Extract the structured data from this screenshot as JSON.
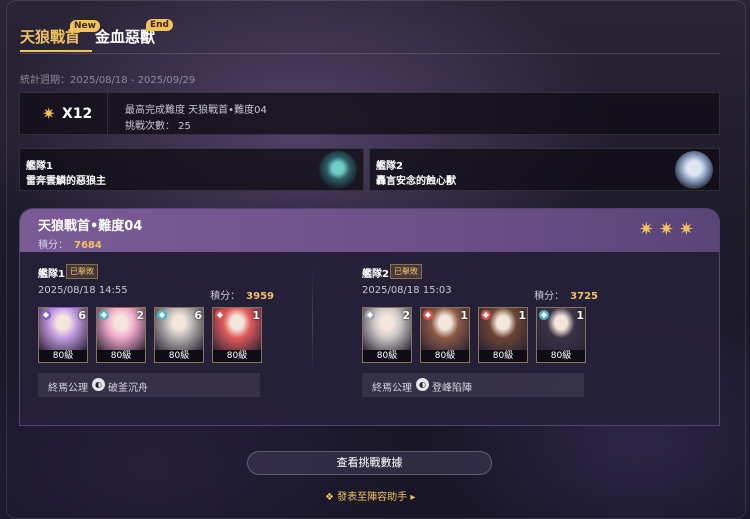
{
  "tabs": [
    {
      "label": "天狼戰首",
      "badge": "New"
    },
    {
      "label": "金血惡獸",
      "badge": "End"
    }
  ],
  "period": "統計週期：2025/08/18 - 2025/09/29",
  "summary": {
    "star_count": "X12",
    "highest_label": "最高完成難度 天狼戰首•難度04",
    "attempts": "挑戰次數： 25"
  },
  "teams": [
    {
      "name": "艦隊1",
      "boss": "雷奔雲鱗的惡狼主",
      "icon": "boss-wolf-icon"
    },
    {
      "name": "艦隊2",
      "boss": "轟言安念的蝕心獸",
      "icon": "boss-beast-icon"
    }
  ],
  "record": {
    "title": "天狼戰首•難度04",
    "score_label": "積分：",
    "score": "7684",
    "stars": "✷✷✷",
    "teams": [
      {
        "name": "艦隊1",
        "status": "已擊敗",
        "date": "2025/08/18 14:55",
        "score_label": "積分：",
        "score": "3959",
        "path": "終焉公理",
        "blessing": "破釜沉舟",
        "chars": [
          {
            "eidolon": "6",
            "level": "80級",
            "color": "#c39be0"
          },
          {
            "eidolon": "2",
            "level": "80級",
            "color": "#f0a9c8"
          },
          {
            "eidolon": "6",
            "level": "80級",
            "color": "#b8b3b0"
          },
          {
            "eidolon": "1",
            "level": "80級",
            "color": "#e05a5a"
          }
        ]
      },
      {
        "name": "艦隊2",
        "status": "已擊敗",
        "date": "2025/08/18 15:03",
        "score_label": "積分：",
        "score": "3725",
        "path": "終焉公理",
        "blessing": "登峰陷陣",
        "chars": [
          {
            "eidolon": "2",
            "level": "80級",
            "color": "#c9c6c2"
          },
          {
            "eidolon": "1",
            "level": "80級",
            "color": "#8a5a44"
          },
          {
            "eidolon": "1",
            "level": "80級",
            "color": "#6b4434"
          },
          {
            "eidolon": "1",
            "level": "80級",
            "color": "#3a3346"
          }
        ]
      }
    ]
  },
  "view_button": "查看挑戰數據",
  "publish_link": "發表至陣容助手 ▸",
  "accent": "#f3c25a"
}
